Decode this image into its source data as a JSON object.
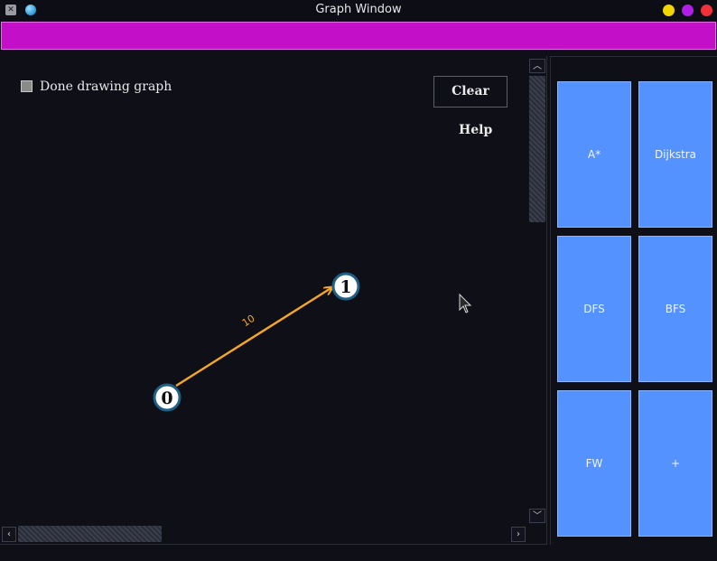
{
  "window": {
    "title": "Graph Window"
  },
  "canvas": {
    "checkbox_label": "Done drawing graph",
    "clear_label": "Clear",
    "help_label": "Help"
  },
  "graph": {
    "nodes": [
      {
        "id": "0",
        "label": "0"
      },
      {
        "id": "1",
        "label": "1"
      }
    ],
    "edges": [
      {
        "from": "0",
        "to": "1",
        "weight": "10",
        "color": "#f5a623"
      }
    ]
  },
  "algorithms": {
    "a_star": "A*",
    "dijkstra": "Dijkstra",
    "dfs": "DFS",
    "bfs": "BFS",
    "fw": "FW",
    "plus": "+"
  },
  "colors": {
    "toolbar": "#c40fc9",
    "button": "#5493ff",
    "edge": "#f5a623",
    "node_border": "#1e5f86"
  }
}
